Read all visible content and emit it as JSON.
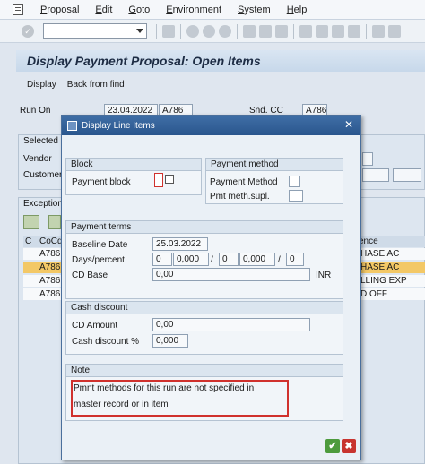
{
  "menu": {
    "items": [
      "Proposal",
      "Edit",
      "Goto",
      "Environment",
      "System",
      "Help"
    ]
  },
  "screen": {
    "title": "Display Payment Proposal: Open Items",
    "app_toolbar": [
      "Display",
      "Back from find"
    ],
    "run_on_label": "Run On",
    "run_on_date": "23.04.2022",
    "run_on_id": "A786",
    "snd_cc_label": "Snd. CC",
    "snd_cc_value": "A786",
    "selected_label": "Selected",
    "vendor_label": "Vendor",
    "customer_label": "Customer",
    "exceptions_label": "Exception",
    "grid": {
      "col1": "C",
      "col2": "CoCd",
      "col_right": "ence",
      "rows": [
        {
          "cocd": "A786",
          "right": "HASE AC"
        },
        {
          "cocd": "A786",
          "right": "HASE AC"
        },
        {
          "cocd": "A786",
          "right": "LLING EXP"
        },
        {
          "cocd": "A786",
          "right": "D OFF"
        }
      ]
    }
  },
  "dialog": {
    "title": "Display Line Items",
    "block": {
      "heading": "Block",
      "payment_block_label": "Payment block"
    },
    "payment_method": {
      "heading": "Payment method",
      "method_label": "Payment Method",
      "supl_label": "Pmt meth.supl."
    },
    "payment_terms": {
      "heading": "Payment terms",
      "baseline_label": "Baseline Date",
      "baseline_value": "25.03.2022",
      "days_label": "Days/percent",
      "days1": "0",
      "pct1": "0,000",
      "days2": "0",
      "pct2": "0,000",
      "days3": "0",
      "slash": "/",
      "cd_base_label": "CD Base",
      "cd_base_value": "0,00",
      "currency": "INR"
    },
    "cash_discount": {
      "heading": "Cash discount",
      "amount_label": "CD Amount",
      "amount_value": "0,00",
      "pct_label": "Cash discount %",
      "pct_value": "0,000"
    },
    "note": {
      "heading": "Note",
      "line1": "Pmnt methods for this run are not specified in",
      "line2": "master record or in item"
    },
    "ok_glyph": "✔",
    "cancel_glyph": "✖",
    "close_glyph": "✕"
  }
}
